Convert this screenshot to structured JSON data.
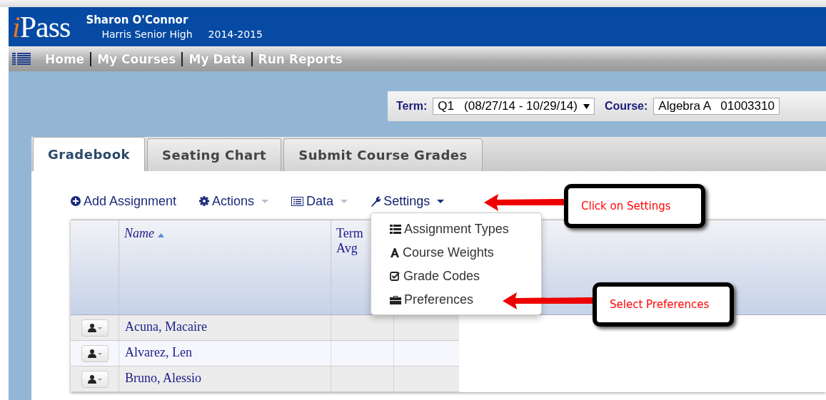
{
  "header": {
    "logo": "iPass",
    "user_name": "Sharon O'Connor",
    "school": "Harris Senior High",
    "year": "2014-2015"
  },
  "nav": [
    "Home",
    "My Courses",
    "My Data",
    "Run Reports"
  ],
  "filters": {
    "term_label": "Term:",
    "term_value": "Q1   (08/27/14 - 10/29/14)",
    "course_label": "Course:",
    "course_value": "Algebra A   01003310"
  },
  "tabs": [
    {
      "label": "Gradebook",
      "selected": true
    },
    {
      "label": "Seating Chart",
      "selected": false
    },
    {
      "label": "Submit Course Grades",
      "selected": false
    }
  ],
  "toolbar": [
    {
      "label": "Add Assignment",
      "caret": false,
      "open": false
    },
    {
      "label": "Actions",
      "caret": true,
      "open": false
    },
    {
      "label": "Data",
      "caret": true,
      "open": false
    },
    {
      "label": "Settings",
      "caret": true,
      "open": true
    }
  ],
  "settings_menu": [
    {
      "label": "Assignment Types"
    },
    {
      "label": "Course Weights"
    },
    {
      "label": "Grade Codes"
    },
    {
      "label": "Preferences"
    }
  ],
  "table": {
    "columns": [
      "Name",
      "Term\nAvg"
    ],
    "rows": [
      "Acuna, Macaire",
      "Alvarez, Len",
      "Bruno, Alessio"
    ]
  },
  "callouts": [
    {
      "text": "Click on Settings"
    },
    {
      "text": "Select Preferences"
    }
  ]
}
